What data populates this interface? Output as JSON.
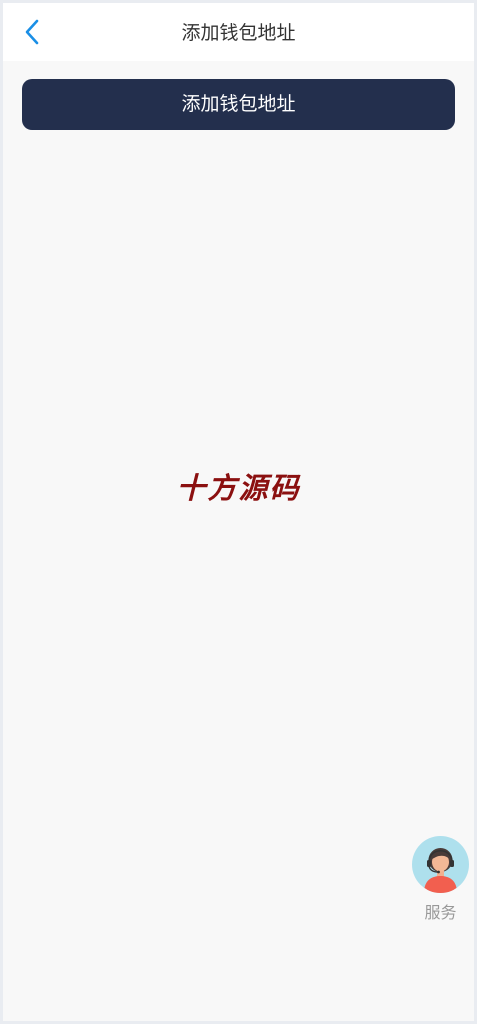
{
  "header": {
    "title": "添加钱包地址",
    "back_icon": "chevron-left-icon"
  },
  "main": {
    "add_button_label": "添加钱包地址",
    "watermark": "十方源码"
  },
  "service": {
    "label": "服务",
    "icon": "customer-service-agent-icon"
  },
  "colors": {
    "button_bg": "#232f4d",
    "back_icon": "#1a8fe6",
    "watermark": "#8b1010",
    "page_bg": "#f8f8f8"
  }
}
